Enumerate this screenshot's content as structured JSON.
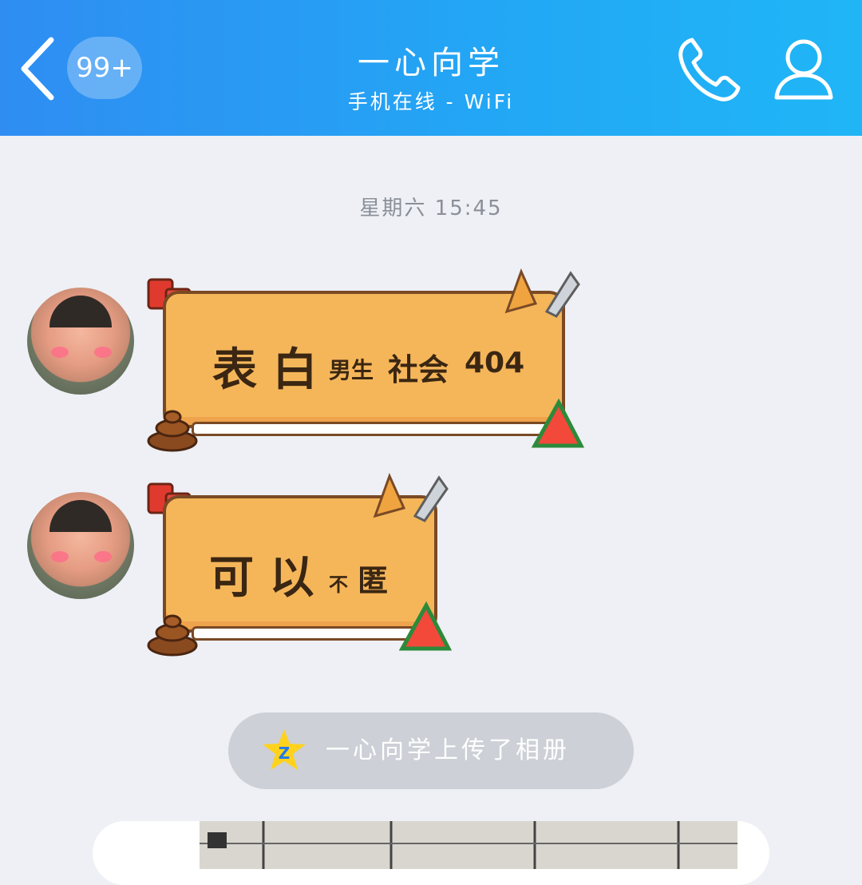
{
  "header": {
    "back_icon": "chevron-left-icon",
    "unread_badge": "99+",
    "title": "一心向学",
    "subtitle": "手机在线 - WiFi",
    "phone_icon": "phone-icon",
    "profile_icon": "user-icon"
  },
  "chat": {
    "timestamp": "星期六 15:45",
    "messages": [
      {
        "big": "表 白",
        "small_a": "男生",
        "small_b": "社会",
        "small_c": "404"
      },
      {
        "big": "可 以",
        "small_a": "不",
        "small_b": "匿"
      }
    ],
    "system_notice": "一心向学上传了相册",
    "system_icon": "qzone-star-icon"
  },
  "colors": {
    "header_start": "#2f8df2",
    "header_end": "#20b6f6",
    "background": "#eef0f5",
    "sticker_fill": "#f5b65a"
  }
}
